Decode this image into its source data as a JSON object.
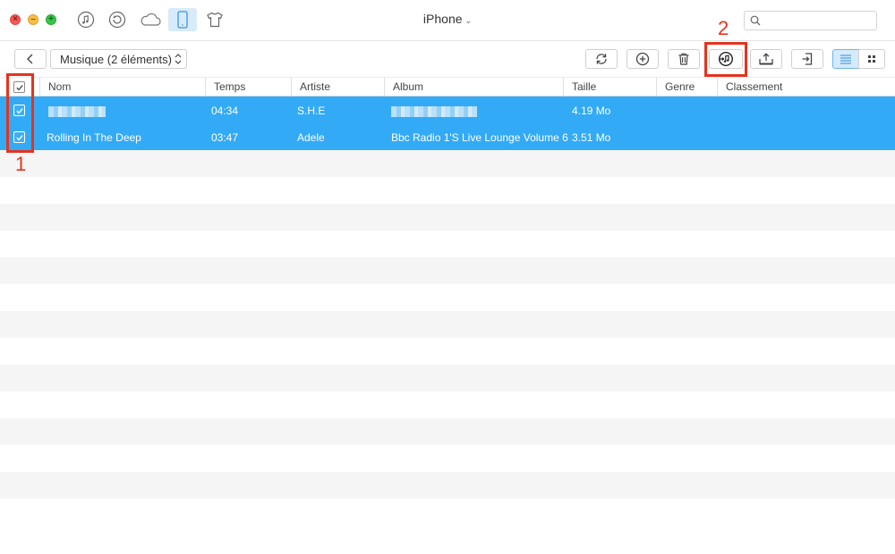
{
  "window": {
    "title": "iPhone"
  },
  "nav_icons": [
    {
      "name": "music-note-icon",
      "active": false
    },
    {
      "name": "history-icon",
      "active": false
    },
    {
      "name": "cloud-icon",
      "active": false
    },
    {
      "name": "iphone-icon",
      "active": true
    },
    {
      "name": "tshirt-icon",
      "active": false
    }
  ],
  "search": {
    "placeholder": "",
    "value": ""
  },
  "toolbar": {
    "category": "Musique (2 éléments)",
    "actions": [
      "refresh-icon",
      "add-icon",
      "delete-icon",
      "to-itunes-icon",
      "to-computer-icon",
      "to-device-icon",
      "list-view-icon",
      "grid-view-icon"
    ],
    "active_view": "list"
  },
  "annotations": {
    "one": "1",
    "two": "2",
    "color": "#e5331f"
  },
  "table": {
    "columns": [
      "Nom",
      "Temps",
      "Artiste",
      "Album",
      "Taille",
      "Genre",
      "Classement"
    ],
    "rows": [
      {
        "name": "",
        "time": "04:34",
        "artist": "S.H.E",
        "album": "",
        "size": "4.19 Mo",
        "genre": "",
        "rating": "",
        "name_blurred": true,
        "album_blurred": true
      },
      {
        "name": "Rolling In The Deep",
        "time": "03:47",
        "artist": "Adele",
        "album": "Bbc Radio 1'S Live Lounge Volume 6",
        "size": "3.51 Mo",
        "genre": "",
        "rating": ""
      }
    ],
    "selection_color": "#33aaf6"
  }
}
